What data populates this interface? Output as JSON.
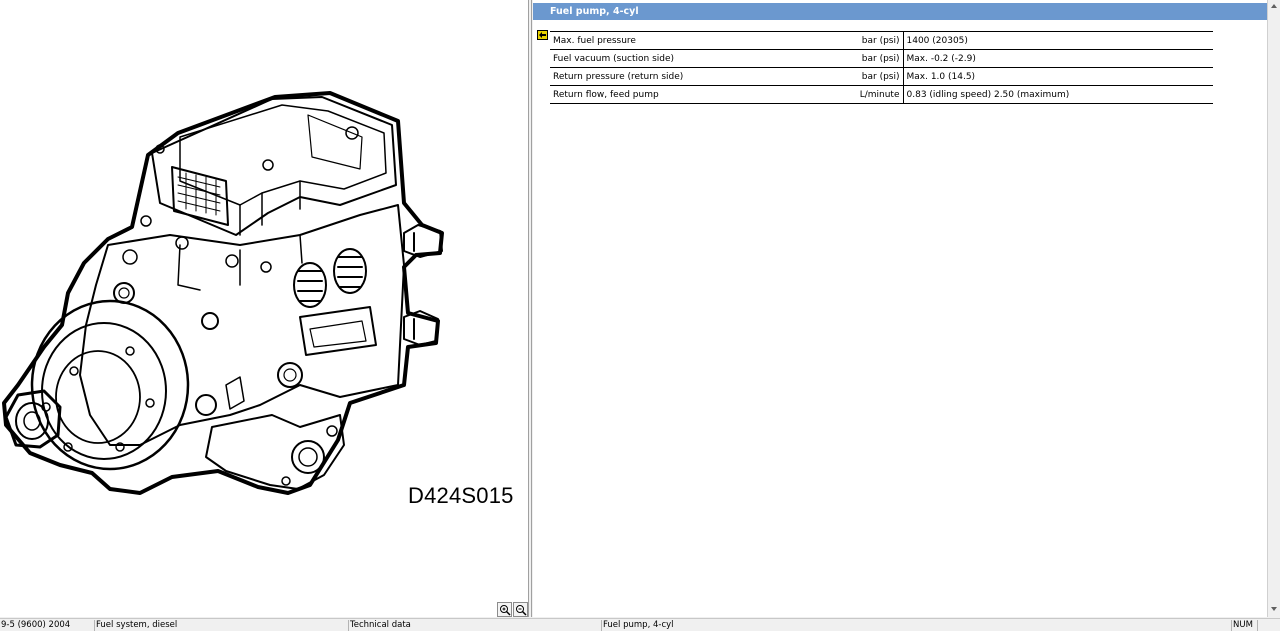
{
  "illustration": {
    "code": "D424S015",
    "zoom_in_icon": "zoom-in-icon",
    "zoom_out_icon": "zoom-out-icon"
  },
  "document": {
    "title": "Fuel pump, 4-cyl",
    "back_icon": "back-arrow-icon",
    "rows": [
      {
        "label": "Max. fuel pressure",
        "unit": "bar (psi)",
        "value": "1400 (20305)"
      },
      {
        "label": "Fuel vacuum (suction side)",
        "unit": "bar (psi)",
        "value": "Max. -0.2 (-2.9)"
      },
      {
        "label": "Return pressure (return side)",
        "unit": "bar (psi)",
        "value": "Max. 1.0 (14.5)"
      },
      {
        "label": "Return flow, feed pump",
        "unit": "L/minute",
        "value": "0.83 (idling speed) 2.50 (maximum)"
      }
    ]
  },
  "status_bar": {
    "model": "9-5 (9600) 2004",
    "system": "Fuel system, diesel",
    "section": "Technical data",
    "topic": "Fuel pump, 4-cyl",
    "indicator": "NUM"
  },
  "colors": {
    "title_bar": "#6b98cf",
    "title_text": "#ffffff"
  }
}
